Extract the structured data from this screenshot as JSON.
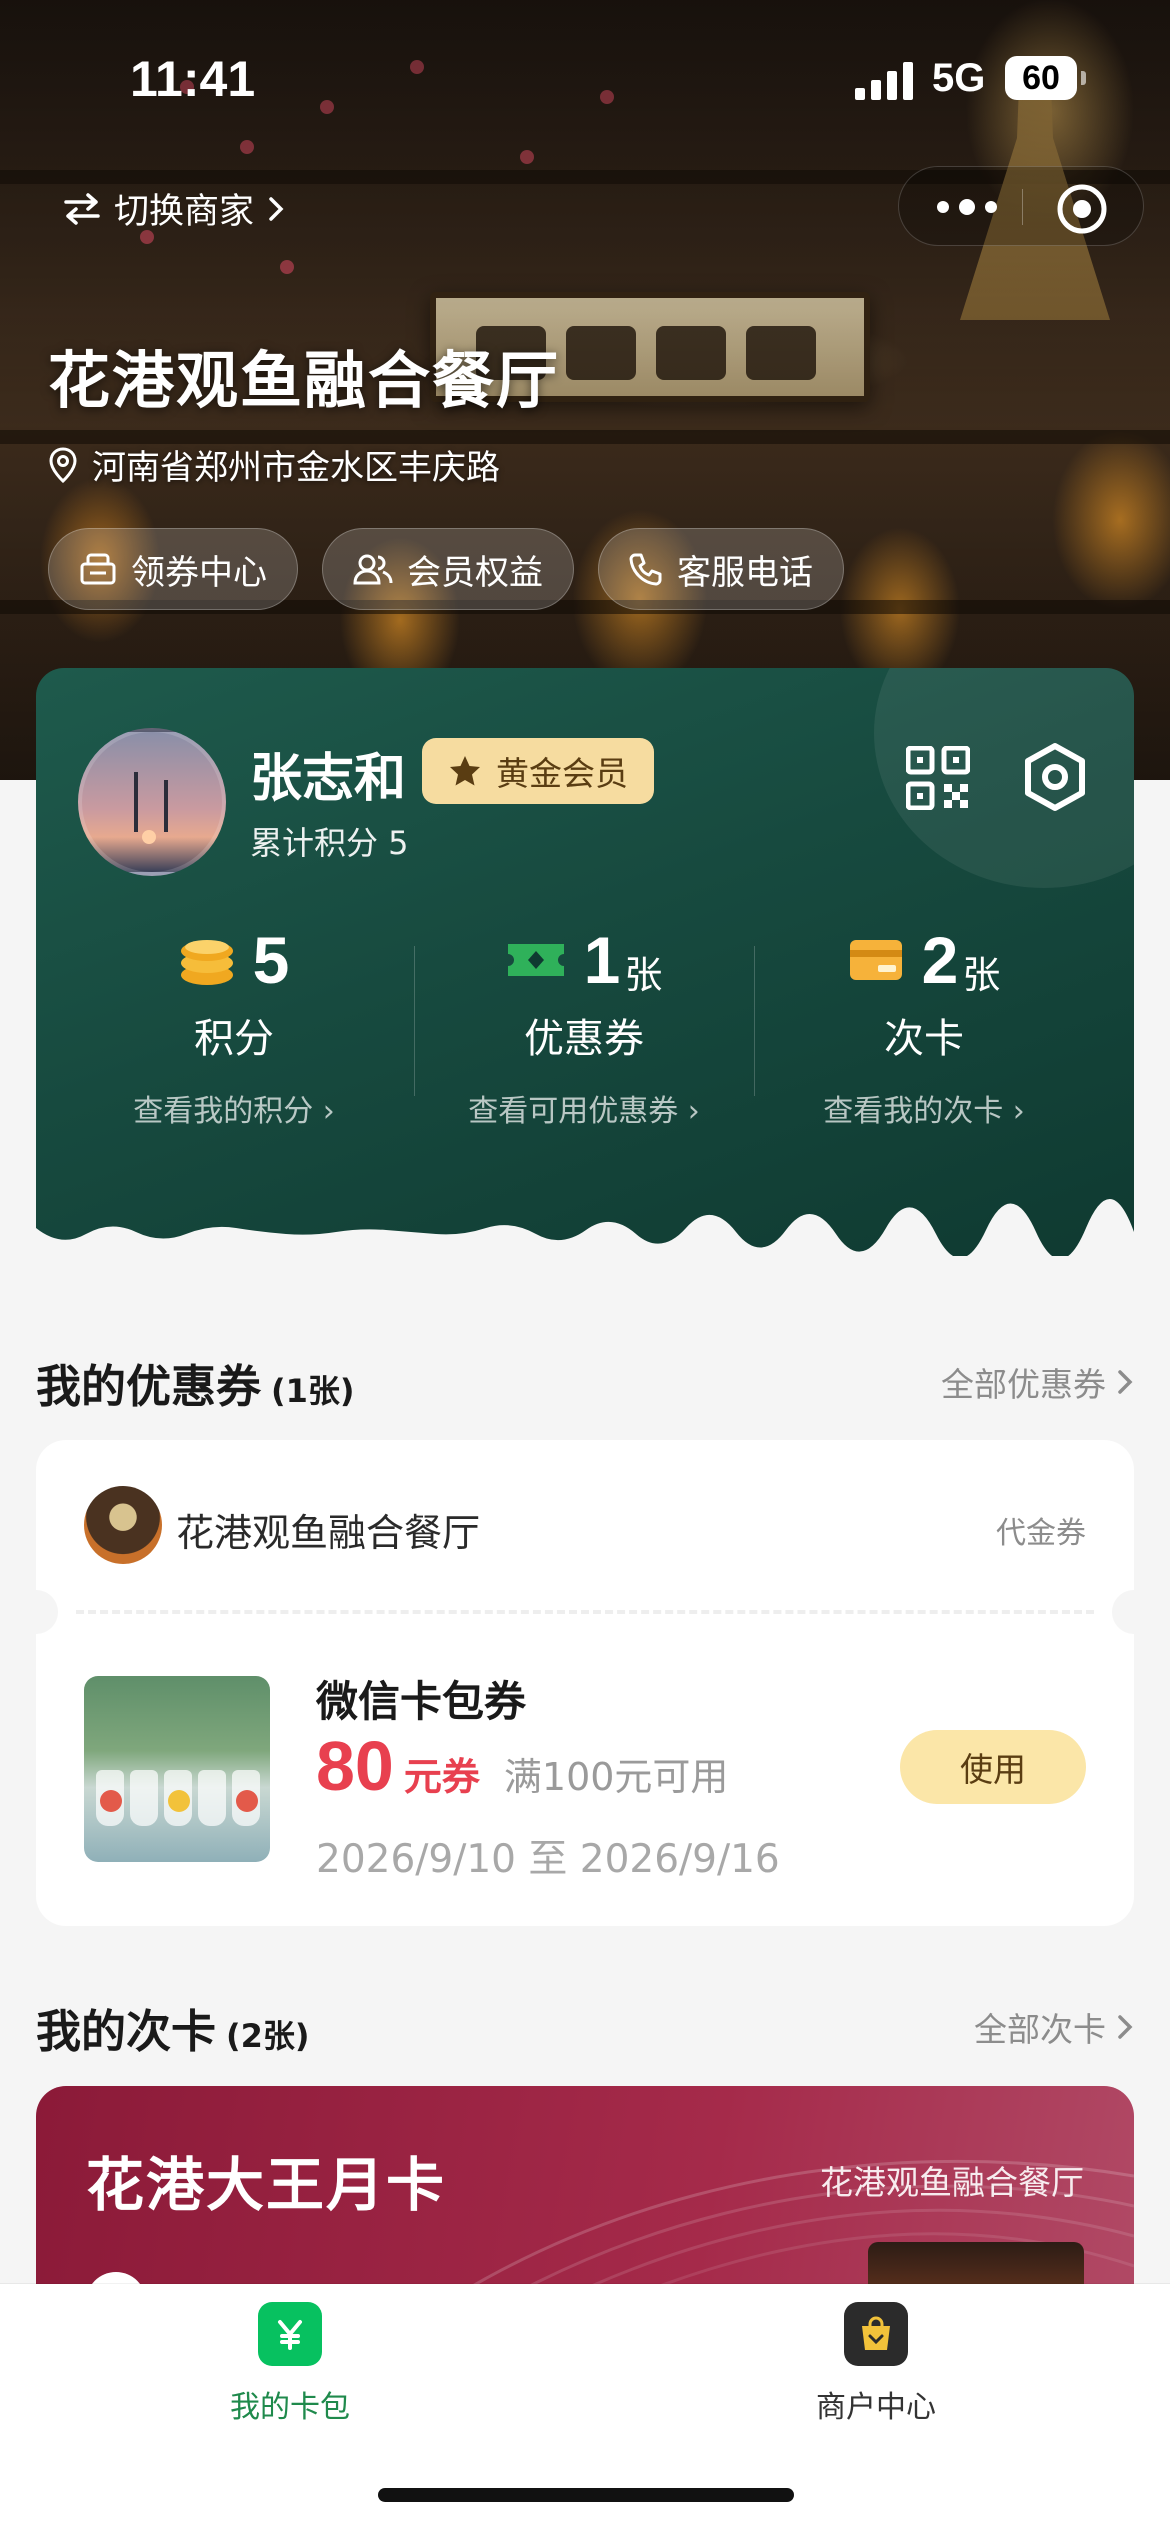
{
  "status_bar": {
    "time": "11:41",
    "network": "5G",
    "battery": "60"
  },
  "header": {
    "switch_label": "切换商家",
    "store_name": "花港观鱼融合餐厅",
    "address": "河南省郑州市金水区丰庆路",
    "quick_actions": [
      {
        "label": "领券中心",
        "icon": "coupon-center-icon"
      },
      {
        "label": "会员权益",
        "icon": "members-icon"
      },
      {
        "label": "客服电话",
        "icon": "phone-icon"
      }
    ]
  },
  "member": {
    "name": "张志和",
    "level": "黄金会员",
    "points_text": "累计积分 5",
    "stats": [
      {
        "value": "5",
        "unit": "",
        "label": "积分",
        "link": "查看我的积分 ›",
        "icon": "coins-icon"
      },
      {
        "value": "1",
        "unit": "张",
        "label": "优惠券",
        "link": "查看可用优惠券 ›",
        "icon": "ticket-icon"
      },
      {
        "value": "2",
        "unit": "张",
        "label": "次卡",
        "link": "查看我的次卡 ›",
        "icon": "card-icon"
      }
    ]
  },
  "coupons": {
    "title": "我的优惠券",
    "count": "(1张)",
    "more": "全部优惠券",
    "item": {
      "merchant": "花港观鱼融合餐厅",
      "type": "代金券",
      "name": "微信卡包券",
      "amount": "80",
      "amount_unit": "元券",
      "condition": "满100元可用",
      "dates": "2026/9/10 至 2026/9/16",
      "action": "使用"
    }
  },
  "times_cards": {
    "title": "我的次卡",
    "count": "(2张)",
    "more": "全部次卡",
    "item": {
      "name": "花港大王月卡",
      "merchant": "花港观鱼融合餐厅"
    }
  },
  "tabbar": {
    "tabs": [
      {
        "label": "我的卡包",
        "active": true,
        "color": "#07c160"
      },
      {
        "label": "商户中心",
        "active": false,
        "color": "#333333"
      }
    ]
  },
  "colors": {
    "member_green": "#174a3f",
    "gold_badge": "#f6dca0",
    "coupon_red": "#e8404f",
    "times_card_red": "#a52a4a"
  }
}
